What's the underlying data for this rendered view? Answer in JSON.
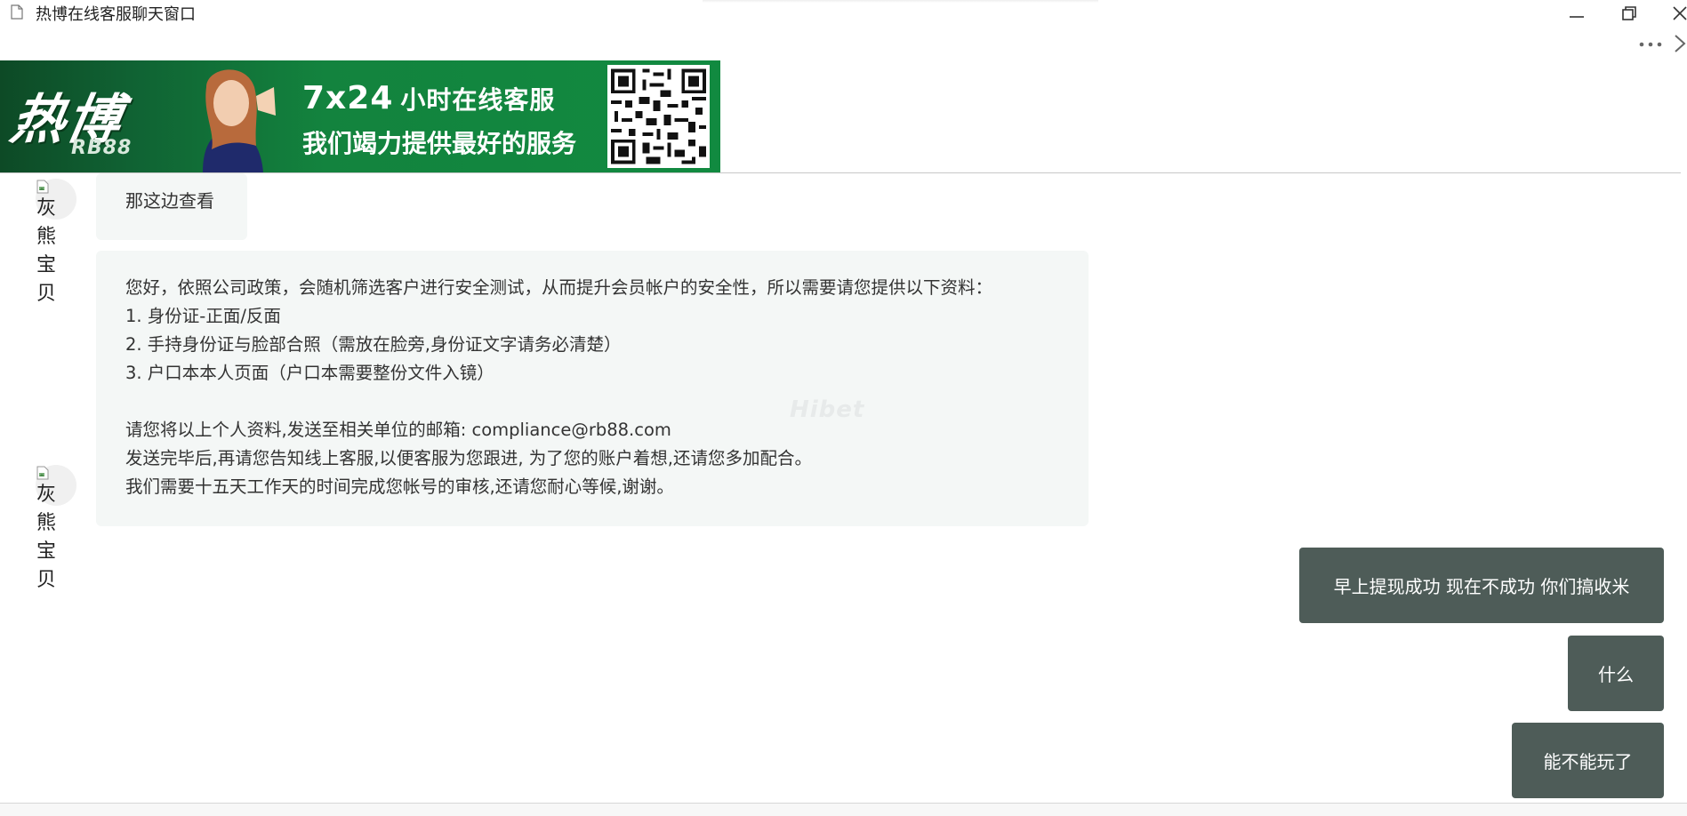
{
  "window": {
    "title": "热博在线客服聊天窗口"
  },
  "icons": {
    "document": "document-icon",
    "minimize": "minimize-icon",
    "restore": "restore-icon",
    "close": "close-icon",
    "more": "more-horizontal-icon",
    "chevron": "chevron-right-icon"
  },
  "banner": {
    "logo": "热博",
    "logo_sub": "RB88",
    "line1_big": "7x24",
    "line1_small": "小时在线客服",
    "line2": "我们竭力提供最好的服务",
    "qr_icon": "qr-code-icon",
    "colors": {
      "dark_green": "#0d4a26",
      "green": "#118a40"
    }
  },
  "chat": {
    "agent_avatar_alt": "灰熊宝贝",
    "messages_left": [
      {
        "lines": [
          "那这边查看"
        ]
      },
      {
        "lines": [
          "您好，依照公司政策，会随机筛选客户进行安全测试，从而提升会员帐户的安全性，所以需要请您提供以下资料：",
          "1. 身份证-正面/反面",
          "2. 手持身份证与脸部合照（需放在脸旁,身份证文字请务必清楚）",
          "3. 户口本本人页面（户口本需要整份文件入镜）",
          "",
          "请您将以上个人资料,发送至相关单位的邮箱: compliance@rb88.com",
          "发送完毕后,再请您告知线上客服,以便客服为您跟进, 为了您的账户着想,还请您多加配合。",
          "我们需要十五天工作天的时间完成您帐号的审核,还请您耐心等候,谢谢。"
        ],
        "watermark": "Hibet"
      }
    ],
    "messages_right": [
      {
        "text": "早上提现成功 现在不成功 你们搞收米"
      },
      {
        "text": "什么"
      },
      {
        "text": "能不能玩了"
      }
    ],
    "colors": {
      "left_bubble": "#f4f7f6",
      "right_bubble": "#4e5c58"
    }
  }
}
